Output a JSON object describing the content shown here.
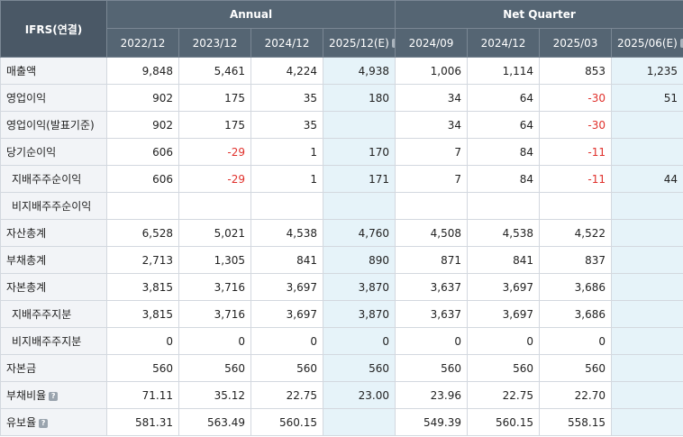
{
  "header": {
    "corner": "IFRS(연결)",
    "annual": "Annual",
    "quarter": "Net Quarter",
    "periods": [
      "2022/12",
      "2023/12",
      "2024/12",
      "2025/12(E)",
      "2024/09",
      "2024/12",
      "2025/03",
      "2025/06(E)"
    ]
  },
  "rows": [
    {
      "label": "매출액",
      "cells": [
        "9,848",
        "5,461",
        "4,224",
        "4,938",
        "1,006",
        "1,114",
        "853",
        "1,235"
      ]
    },
    {
      "label": "영업이익",
      "cells": [
        "902",
        "175",
        "35",
        "180",
        "34",
        "64",
        "-30",
        "51"
      ]
    },
    {
      "label": "영업이익(발표기준)",
      "cells": [
        "902",
        "175",
        "35",
        "",
        "34",
        "64",
        "-30",
        ""
      ]
    },
    {
      "label": "당기순이익",
      "cells": [
        "606",
        "-29",
        "1",
        "170",
        "7",
        "84",
        "-11",
        ""
      ]
    },
    {
      "label": "지배주주순이익",
      "cells": [
        "606",
        "-29",
        "1",
        "171",
        "7",
        "84",
        "-11",
        "44"
      ]
    },
    {
      "label": "비지배주주순이익",
      "cells": [
        "",
        "",
        "",
        "",
        "",
        "",
        "",
        ""
      ]
    },
    {
      "label": "자산총계",
      "cells": [
        "6,528",
        "5,021",
        "4,538",
        "4,760",
        "4,508",
        "4,538",
        "4,522",
        ""
      ]
    },
    {
      "label": "부채총계",
      "cells": [
        "2,713",
        "1,305",
        "841",
        "890",
        "871",
        "841",
        "837",
        ""
      ]
    },
    {
      "label": "자본총계",
      "cells": [
        "3,815",
        "3,716",
        "3,697",
        "3,870",
        "3,637",
        "3,697",
        "3,686",
        ""
      ]
    },
    {
      "label": "지배주주지분",
      "cells": [
        "3,815",
        "3,716",
        "3,697",
        "3,870",
        "3,637",
        "3,697",
        "3,686",
        ""
      ]
    },
    {
      "label": "비지배주주지분",
      "cells": [
        "0",
        "0",
        "0",
        "0",
        "0",
        "0",
        "0",
        ""
      ]
    },
    {
      "label": "자본금",
      "cells": [
        "560",
        "560",
        "560",
        "560",
        "560",
        "560",
        "560",
        ""
      ]
    },
    {
      "label": "부채비율",
      "cells": [
        "71.11",
        "35.12",
        "22.75",
        "23.00",
        "23.96",
        "22.75",
        "22.70",
        ""
      ]
    },
    {
      "label": "유보율",
      "cells": [
        "581.31",
        "563.49",
        "560.15",
        "",
        "549.39",
        "560.15",
        "558.15",
        ""
      ]
    }
  ]
}
